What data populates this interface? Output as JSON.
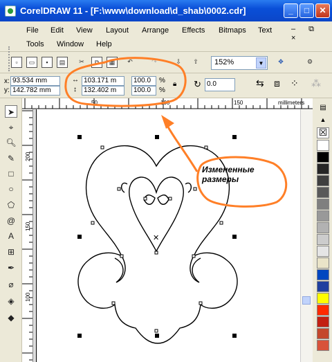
{
  "window": {
    "title": "CorelDRAW 11 - [F:\\www\\download\\d_shab\\0002.cdr]",
    "min": "_",
    "max": "□",
    "close": "✕"
  },
  "menu": {
    "row1": [
      "File",
      "Edit",
      "View",
      "Layout",
      "Arrange",
      "Effects",
      "Bitmaps",
      "Text"
    ],
    "row2": [
      "Tools",
      "Window",
      "Help"
    ],
    "sys": "– ⧉ ×"
  },
  "toolbar": {
    "zoom": "152%",
    "zoom_arrow": "▼"
  },
  "properties": {
    "x_label": "x:",
    "x": "93.534 mm",
    "y_label": "y:",
    "y": "142.782 mm",
    "width": "103.171 m",
    "height": "132.402 m",
    "scale_x": "100.0",
    "scale_y": "100.0",
    "percent": "%",
    "rotation": "0.0"
  },
  "ruler": {
    "h_ticks": [
      "50",
      "100",
      "150"
    ],
    "units": "millimeters",
    "v_ticks": [
      "200",
      "150",
      "100"
    ]
  },
  "annotation": {
    "text_line1": "Измененные",
    "text_line2": "размеры"
  },
  "colors": {
    "titlebar": "#0b46c8",
    "highlight": "#f08040",
    "accent": "#ff7f27"
  },
  "palette": [
    "#ffffff",
    "#000000",
    "#262626",
    "#3f3f3f",
    "#595959",
    "#7f7f7f",
    "#999999",
    "#b2b2b2",
    "#cccccc",
    "#e5e5e5",
    "#eae4c8",
    "#0047c0",
    "#1f3f9f",
    "#fffd00",
    "#ff2a00",
    "#c22012",
    "#c4472b",
    "#d8533a"
  ]
}
